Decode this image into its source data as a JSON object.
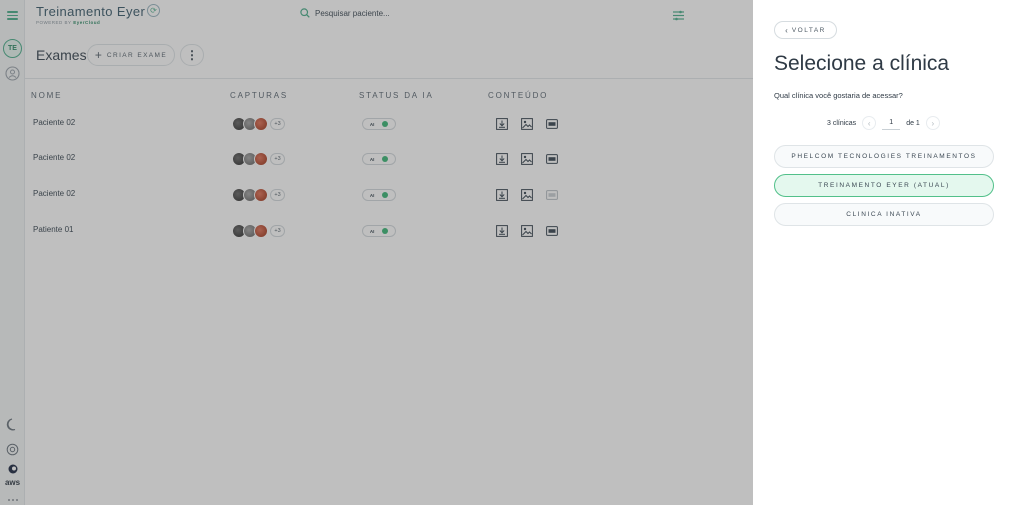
{
  "app": {
    "brand_title": "Treinamento Eyer",
    "brand_sub_prefix": "POWERED BY ",
    "brand_sub_product": "EyerCloud"
  },
  "search": {
    "placeholder": "Pesquisar paciente..."
  },
  "page": {
    "title": "Exames",
    "create_label": "CRIAR EXAME",
    "more_label": "⋮"
  },
  "table": {
    "headers": {
      "name": "NOME",
      "captures": "CAPTURAS",
      "ai_status": "STATUS DA IA",
      "content": "CONTEÚDO"
    },
    "rows": [
      {
        "name": "Paciente 02",
        "captures_more": "+3",
        "ai_label": "AI"
      },
      {
        "name": "Paciente 02",
        "captures_more": "+3",
        "ai_label": "AI"
      },
      {
        "name": "Paciente 02",
        "captures_more": "+3",
        "ai_label": "AI"
      },
      {
        "name": "Patiente 01",
        "captures_more": "+3",
        "ai_label": "AI"
      }
    ]
  },
  "rail": {
    "avatar_initials": "TE",
    "aws_label": "aws"
  },
  "panel": {
    "back_label": "VOLTAR",
    "title": "Selecione a clínica",
    "subtitle": "Qual clínica você gostaria de acessar?",
    "pager_count": "3 clínicas",
    "pager_page": "1",
    "pager_of": "de 1",
    "clinics": [
      {
        "label": "PHELCOM TECNOLOGIES TREINAMENTOS",
        "active": false
      },
      {
        "label": "TREINAMENTO EYER (ATUAL)",
        "active": true
      },
      {
        "label": "CLINICA INATIVA",
        "active": false
      }
    ]
  },
  "colors": {
    "accent": "#4caf8c",
    "active_clinic_bg": "#e4f8ee",
    "active_clinic_border": "#52c08a",
    "ai_dot": "#3cb878"
  }
}
